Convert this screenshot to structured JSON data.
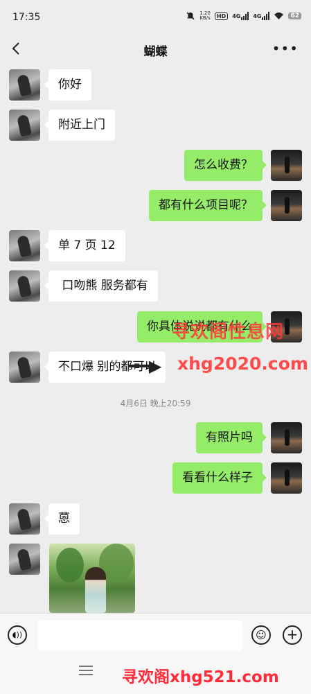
{
  "status_bar": {
    "time": "17:35",
    "net_speed": "1.20\nKB/s",
    "hd": "HD",
    "sig1": "4G",
    "sig2": "4G",
    "battery": "62"
  },
  "header": {
    "title": "蝴蝶",
    "back_icon": "chevron-left-icon",
    "more_icon": "more-dots-icon"
  },
  "messages": [
    {
      "side": "left",
      "text": "你好"
    },
    {
      "side": "left",
      "text": "附近上门"
    },
    {
      "side": "right",
      "text": "怎么收费？"
    },
    {
      "side": "right",
      "text": "都有什么项目呢？"
    },
    {
      "side": "left",
      "text": "单 7 页 12"
    },
    {
      "side": "left",
      "text": " 口吻熊 服务都有"
    },
    {
      "side": "right",
      "text": "你具体说说都有什么"
    },
    {
      "side": "left",
      "text": "不口爆 别的都可以"
    },
    {
      "side": "right",
      "text": "有照片吗"
    },
    {
      "side": "right",
      "text": "看看什么样子"
    },
    {
      "side": "left",
      "text": "蒽"
    }
  ],
  "timestamp": "4月6日 晚上20:59",
  "watermarks": {
    "top_cn": "寻欢阁性息网",
    "top_url": "xhg2020.com",
    "bottom": "寻欢阁xhg521.com"
  },
  "input_bar": {
    "value": "",
    "placeholder": "",
    "voice_icon": "voice-icon",
    "emoji_icon": "emoji-icon",
    "plus_icon": "plus-icon"
  },
  "colors": {
    "background": "#ededed",
    "bubble_self": "#95ec69",
    "bubble_other": "#ffffff",
    "watermark": "#ff3a3a"
  }
}
